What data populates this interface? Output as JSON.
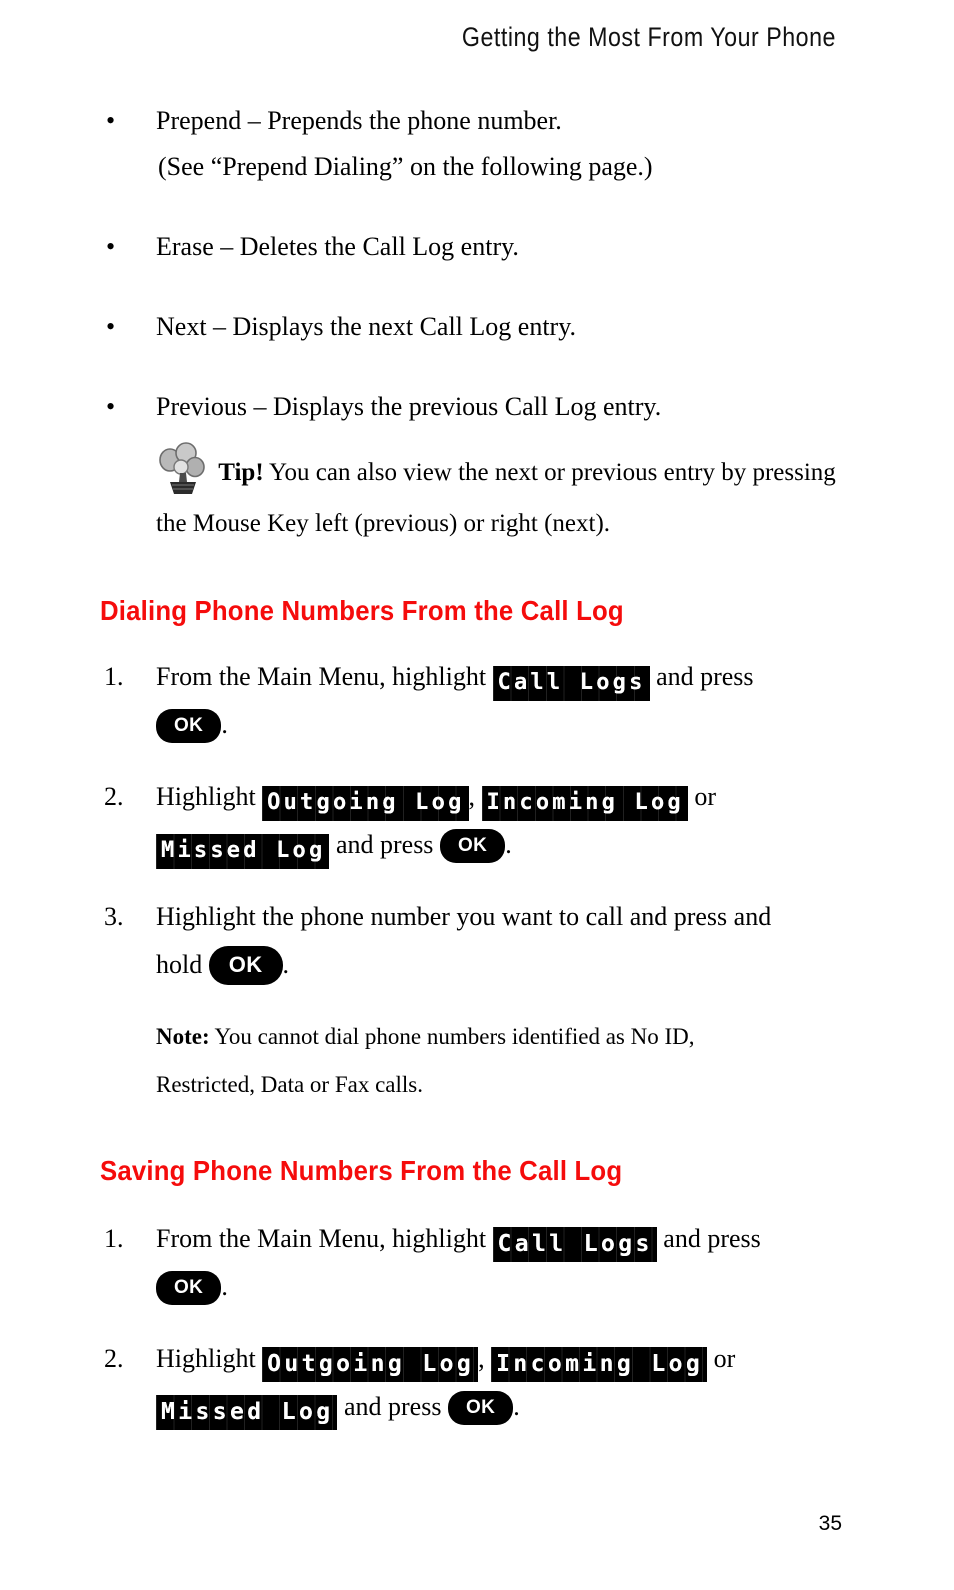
{
  "header": {
    "running_title": "Getting the Most From Your Phone"
  },
  "bullets": [
    {
      "marker": "•",
      "line1": "Prepend – Prepends the phone number.",
      "line2": "(See “Prepend Dialing” on the following page.)"
    },
    {
      "marker": "•",
      "line1": "Erase – Deletes the Call Log entry.",
      "line2": ""
    },
    {
      "marker": "•",
      "line1": "Next – Displays the next Call Log entry.",
      "line2": ""
    },
    {
      "marker": "•",
      "line1": "Previous – Displays the previous Call Log entry.",
      "line2": ""
    }
  ],
  "tip": {
    "icon": "tip-bulb-cluster-icon",
    "label": "Tip!",
    "line1": "You can also view the next or previous entry by pressing",
    "line2": "the Mouse Key left (previous) or right (next)."
  },
  "sections": [
    {
      "id": "dialing",
      "heading": "Dialing Phone Numbers From the Call Log",
      "steps": [
        {
          "number": "1.",
          "pre": "From the Main Menu, highlight",
          "lcd1": "Call Logs",
          "mid": "and press",
          "line2_key": "OK",
          "line2_after": "."
        },
        {
          "number": "2.",
          "pre": "Highlight",
          "lcd1": "Outgoing Log",
          "sep1": ",",
          "lcd2": "Incoming Log",
          "post": "or",
          "lcd3": "Missed Log",
          "mid2": "and press",
          "key": "OK",
          "after": "."
        },
        {
          "number": "3.",
          "line1": "Highlight the phone number you want to call and press and",
          "line2_pre": "hold",
          "key": "OK",
          "after": "."
        }
      ],
      "note": {
        "label": "Note:",
        "line1": "You cannot dial phone numbers identified as No ID,",
        "line2": "Restricted, Data or Fax calls."
      }
    },
    {
      "id": "saving",
      "heading": "Saving Phone Numbers From the Call Log",
      "steps": [
        {
          "number": "1.",
          "pre": "From the Main Menu, highlight",
          "lcd1": "Call Logs",
          "mid": "and press",
          "line2_key": "OK",
          "line2_after": "."
        },
        {
          "number": "2.",
          "pre": "Highlight",
          "lcd1": "Outgoing Log",
          "sep1": ",",
          "lcd2": "Incoming Log",
          "post": "or",
          "lcd3": "Missed Log",
          "mid2": "and press",
          "key": "OK",
          "after": "."
        }
      ]
    }
  ],
  "footer": {
    "page_number": "35"
  },
  "colors": {
    "heading_red": "#F50C0C",
    "text_black": "#000000",
    "page_background": "#FFFFFF"
  }
}
